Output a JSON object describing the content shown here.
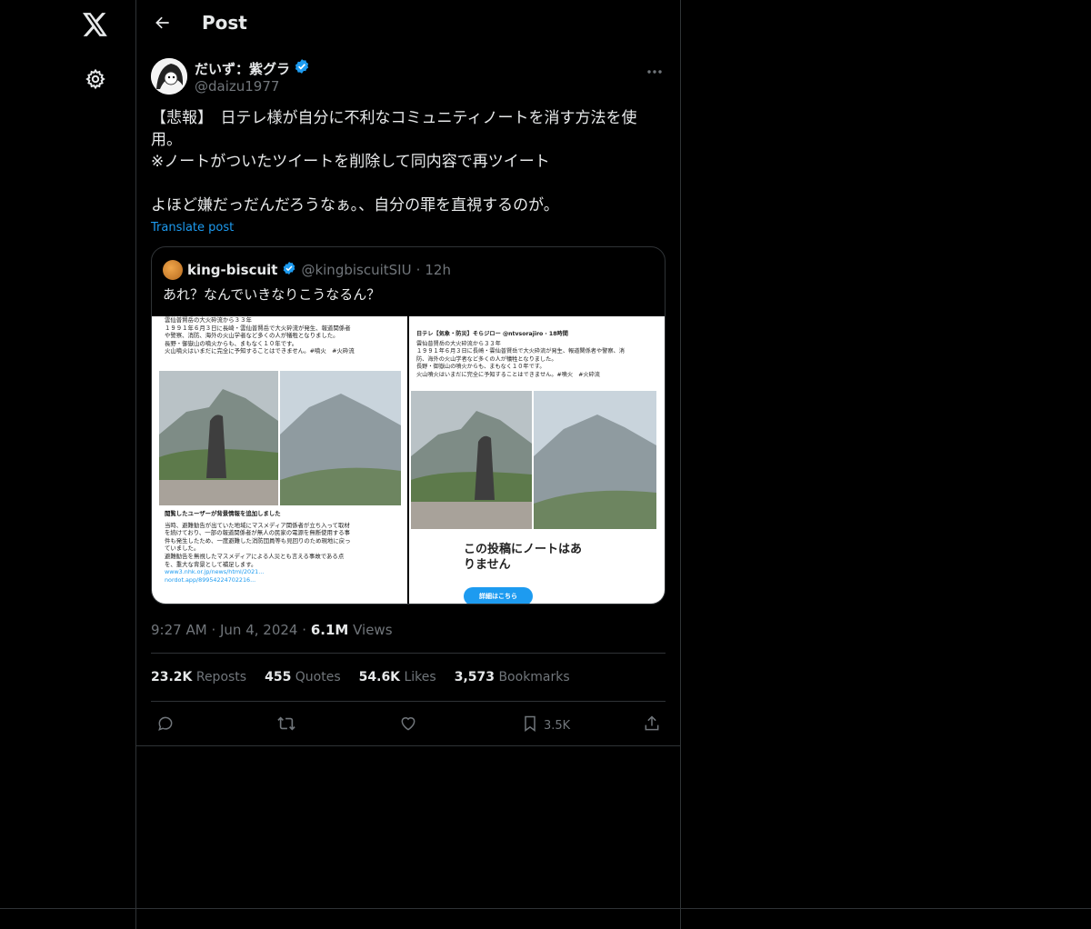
{
  "nav": {
    "logo_icon": "x-logo-icon",
    "settings_icon": "gear-icon"
  },
  "header": {
    "title": "Post",
    "back_icon": "arrow-left-icon"
  },
  "post": {
    "author_name": "だいず：紫グラ",
    "author_handle": "@daizu1977",
    "verified": true,
    "text": "【悲報】　日テレ様が自分に不利なコミュニティノートを消す方法を使用。\n※ノートがついたツイートを削除して同内容で再ツイート\n\nよほど嫌だっだんだろうなぁ。、自分の罪を直視するのが。",
    "translate_label": "Translate post",
    "time": "9:27 AM",
    "sep": "·",
    "date": "Jun 4, 2024",
    "views_count": "6.1M",
    "views_label": "Views"
  },
  "quote": {
    "name": "king-biscuit",
    "handle": "@kingbiscuitSIU",
    "dot": "·",
    "time": "12h",
    "text": "あれ？なんでいきなりこうなるん？",
    "media_left": {
      "lines": [
        "雲仙普賢岳の大火砕流から３３年",
        "１９９１年６月３日に長崎・雲仙普賢岳で大火砕流が発生、報道関係者",
        "や警察、消防、海外の火山学者など多くの人が犠牲となりました。",
        "長野・御嶽山の噴火からも、まもなく１０年です。",
        "火山噴火はいまだに完全に予知することはできません。#噴火　#火砕流"
      ],
      "note_title": "閲覧したユーザーが背景情報を追加しました",
      "note_lines": [
        "当時、避難勧告が出ていた地域にマスメディア関係者が立ち入って取材",
        "を続けており、一部の報道関係者が無人の民家の電源を無断使用する事",
        "件も発生したため、一度避難した消防団員等も見回りのため現地に戻っ",
        "ていました。",
        "避難勧告を無視したマスメディアによる人災とも言える事故である点",
        "を、重大な背景として補足します。"
      ],
      "links": [
        "www3.nhk.or.jp/news/html/2021...",
        "nordot.app/89954224702216..."
      ]
    },
    "media_right": {
      "account_line": "日テレ【気象・防災】そらジロー @ntvsorajiro · 18時間",
      "lines": [
        "雲仙普賢岳の大火砕流から３３年",
        "１９９１年６月３日に長崎・雲仙普賢岳で大火砕流が発生、報道関係者や警察、消",
        "防、海外の火山学者など多くの人が犠牲となりました。",
        "長野・御嶽山の噴火からも、まもなく１０年です。",
        "火山噴火はいまだに完全に予知することはできません。#噴火　#火砕流"
      ],
      "no_note_text_1": "この投稿にノートはあ",
      "no_note_text_2": "りません",
      "details_button": "詳細はこちら"
    }
  },
  "stats": {
    "reposts_count": "23.2K",
    "reposts_label": "Reposts",
    "quotes_count": "455",
    "quotes_label": "Quotes",
    "likes_count": "54.6K",
    "likes_label": "Likes",
    "bookmarks_count": "3,573",
    "bookmarks_label": "Bookmarks"
  },
  "actions": {
    "reply_icon": "reply-icon",
    "repost_icon": "repost-icon",
    "like_icon": "heart-icon",
    "bookmark_icon": "bookmark-icon",
    "bookmark_count": "3.5K",
    "share_icon": "share-icon"
  },
  "colors": {
    "accent": "#1d9bf0",
    "text": "#e7e9ea",
    "muted": "#71767b",
    "border": "#2f3336",
    "background": "#000000"
  }
}
